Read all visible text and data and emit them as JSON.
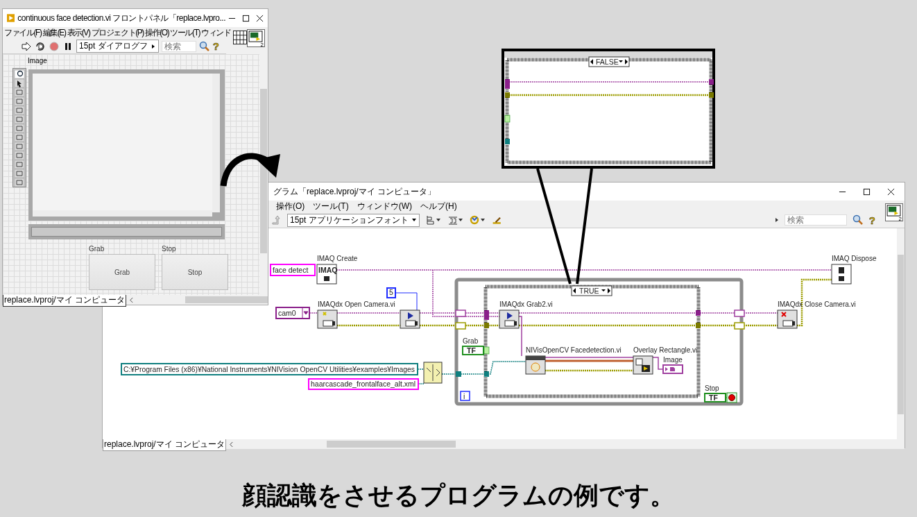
{
  "front_panel": {
    "title": "continuous face detection.vi フロントパネル「replace.lvpro...",
    "menu": [
      "ファイル(F)",
      "編集(E)",
      "表示(V)",
      "プロジェクト(P)",
      "操作(O)",
      "ツール(T)",
      "ウィンド"
    ],
    "font_selector": "15pt ダイアログフ",
    "search": {
      "placeholder": "検索"
    },
    "help": "?",
    "connector_number": "2",
    "image_label": "Image",
    "buttons": [
      {
        "label": "Grab",
        "caption": "Grab"
      },
      {
        "label": "Stop",
        "caption": "Stop"
      }
    ],
    "status": "replace.lvproj/マイ コンピュータ"
  },
  "block_diagram": {
    "title": "グラム「replace.lvproj/マイ コンピュータ」",
    "menu": [
      "操作(O)",
      "ツール(T)",
      "ウィンドウ(W)",
      "ヘルプ(H)"
    ],
    "font_selector": "15pt アプリケーションフォント",
    "search": {
      "placeholder": "検索"
    },
    "help": "?",
    "connector_number": "2",
    "constants": [
      {
        "kind": "string",
        "text": "face detect"
      },
      {
        "kind": "ring",
        "text": "cam0"
      },
      {
        "kind": "numeric",
        "text": "5"
      },
      {
        "kind": "path",
        "text": "C:¥Program Files (x86)¥National Instruments¥NIVision OpenCV Utilities¥examples¥Images"
      },
      {
        "kind": "string",
        "text": "haarcascade_frontalface_alt.xml"
      }
    ],
    "nodes": [
      {
        "kind": "create",
        "label": "IMAQ Create",
        "icon_text": "IMAQ"
      },
      {
        "kind": "open",
        "label": "IMAQdx Open Camera.vi"
      },
      {
        "kind": "configure"
      },
      {
        "kind": "grab",
        "label": "IMAQdx Grab2.vi"
      },
      {
        "kind": "face",
        "label": "NIVisOpenCV Facedetection.vi"
      },
      {
        "kind": "overlay",
        "label": "Overlay Rectangle.vi"
      },
      {
        "kind": "close",
        "label": "IMAQdx Close Camera.vi"
      },
      {
        "kind": "dispose",
        "label": "IMAQ Dispose"
      },
      {
        "kind": "build-path"
      }
    ],
    "terminals": [
      {
        "kind": "control",
        "label": "Grab",
        "text": "TF"
      },
      {
        "kind": "indicator",
        "label": "Image"
      },
      {
        "kind": "control",
        "label": "Stop",
        "text": "TF"
      }
    ],
    "case_label": "TRUE",
    "iteration": "i",
    "status": "replace.lvproj/マイ コンピュータ"
  },
  "callout": {
    "case_label": "FALSE"
  },
  "caption": "顔認識をさせるプログラムの例です。"
}
